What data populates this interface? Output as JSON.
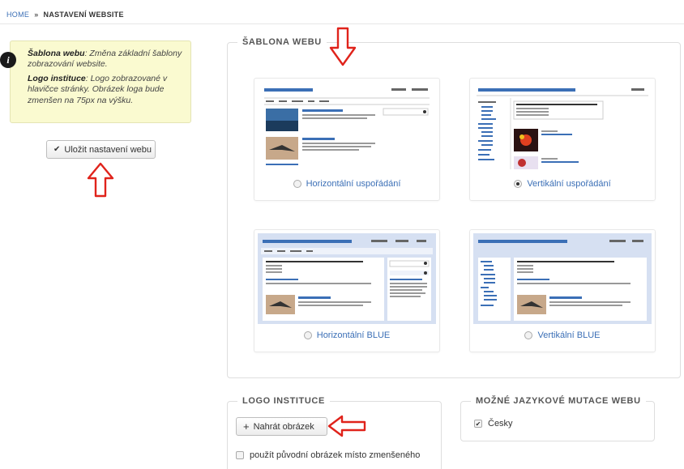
{
  "breadcrumb": {
    "home": "HOME",
    "separator": "»",
    "current": "NASTAVENÍ WEBSITE"
  },
  "info": {
    "icon": "info-icon",
    "line1_title": "Šablona webu",
    "line1_text": ": Změna základní šablony zobrazování website.",
    "line2_title": "Logo instituce",
    "line2_text": ": Logo zobrazované v hlavičce stránky. Obrázek loga bude zmenšen na 75px na výšku."
  },
  "save_button": {
    "icon": "check-icon",
    "label": "Uložit nastavení webu"
  },
  "template": {
    "legend": "ŠABLONA WEBU",
    "options": [
      {
        "label": "Horizontální uspořádání",
        "selected": false
      },
      {
        "label": "Vertikální uspořádání",
        "selected": true
      },
      {
        "label": "Horizontální BLUE",
        "selected": false
      },
      {
        "label": "Vertikální BLUE",
        "selected": false
      }
    ]
  },
  "logo": {
    "legend": "LOGO INSTITUCE",
    "upload_label": "Nahrát obrázek",
    "upload_icon": "plus-icon",
    "use_original_label": "použít původní obrázek místo zmenšeného",
    "use_original_checked": false
  },
  "languages": {
    "legend": "MOŽNÉ JAZYKOVÉ MUTACE WEBU",
    "items": [
      {
        "label": "Česky",
        "checked": true
      }
    ]
  },
  "colors": {
    "link": "#3b6fb6",
    "annotation_arrow": "#e0231b",
    "info_bg": "#fafad0",
    "blue_theme": "#d6e0f2"
  }
}
